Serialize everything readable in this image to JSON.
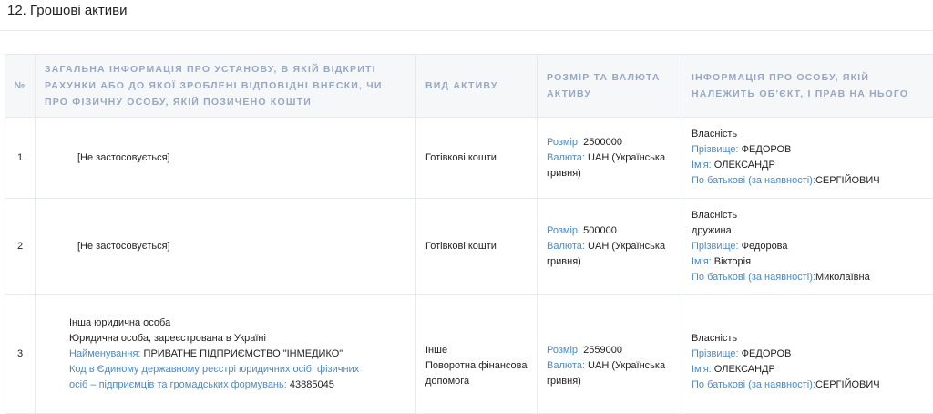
{
  "section": {
    "title": "12. Грошові активи"
  },
  "table": {
    "headers": {
      "num": "№",
      "institution": "Загальна інформація про установу, в якій відкриті рахунки або до якої зроблені відповідні внески, чи про фізичну особу, якій позичено кошти",
      "asset_type": "Вид активу",
      "amount": "Розмір та валюта активу",
      "owner": "Інформація про особу, якій належить об'єкт, і прав на нього"
    },
    "labels": {
      "size": "Розмір:",
      "currency": "Валюта:",
      "surname": "Прізвище:",
      "name": "Ім'я:",
      "patronymic": "По батькові (за наявності):",
      "org_name": "Найменування:",
      "edr_code": "Код в Єдиному державному реєстрі юридичних осіб, фізичних осіб – підприємців та громадських формувань:"
    },
    "rows": [
      {
        "num": "1",
        "institution": "[Не застосовується]",
        "asset_type": "Готівкові кошти",
        "size": "2500000",
        "currency": "UAH (Українська гривня)",
        "owner_right": "Власність",
        "owner_relation": "",
        "surname": "ФЕДОРОВ",
        "name": "ОЛЕКСАНДР",
        "patronymic": "СЕРГІЙОВИЧ"
      },
      {
        "num": "2",
        "institution": "[Не застосовується]",
        "asset_type": "Готівкові кошти",
        "size": "500000",
        "currency": "UAH (Українська гривня)",
        "owner_right": "Власність",
        "owner_relation": "дружина",
        "surname": "Федорова",
        "name": "Вікторія",
        "patronymic": "Миколаївна"
      },
      {
        "num": "3",
        "institution_type": "Інша юридична особа",
        "institution_kind": "Юридична особа, зареєстрована в Україні",
        "org_name": "ПРИВАТНЕ ПІДПРИЄМСТВО \"ІНМЕДИКО\"",
        "edr_code": "43885045",
        "asset_type_1": "Інше",
        "asset_type_2": "Поворотна фінансова допомога",
        "size": "2559000",
        "currency": "UAH (Українська гривня)",
        "owner_right": "Власність",
        "surname": "ФЕДОРОВ",
        "name": "ОЛЕКСАНДР",
        "patronymic": "СЕРГІЙОВИЧ"
      }
    ]
  }
}
